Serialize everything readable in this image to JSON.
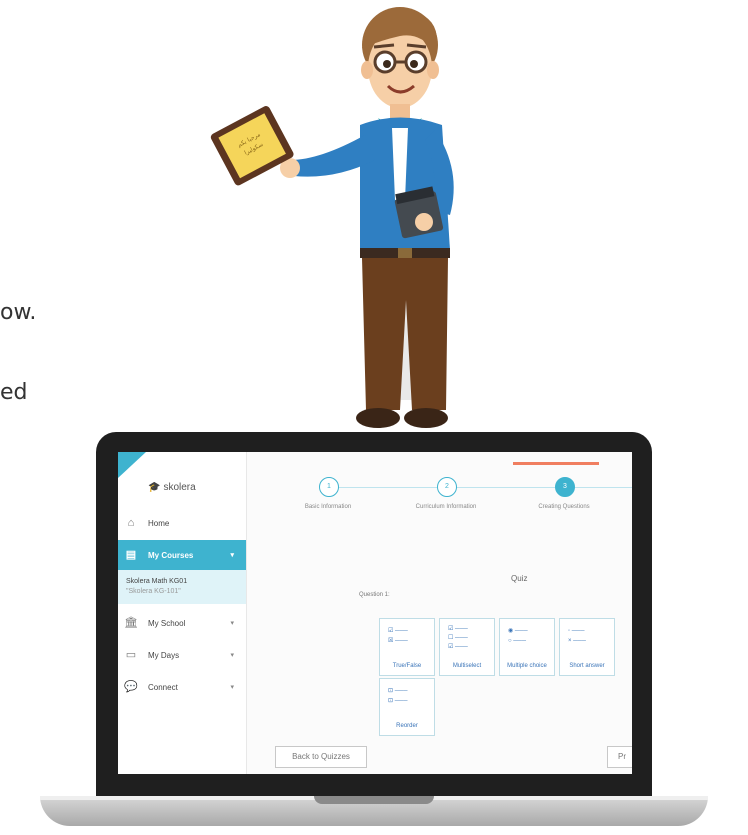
{
  "background_text": {
    "line1": "ow.",
    "line2": "ed"
  },
  "app": {
    "logo": "skolera",
    "sidebar": {
      "home": "Home",
      "my_courses": "My Courses",
      "course_name": "Skolera Math KG01",
      "course_code": "\"Skolera KG-101\"",
      "my_school": "My School",
      "my_days": "My Days",
      "connect": "Connect"
    },
    "steps": [
      {
        "number": "1",
        "label": "Basic Information"
      },
      {
        "number": "2",
        "label": "Curriculum Information"
      },
      {
        "number": "3",
        "label": "Creating Questions"
      }
    ],
    "quiz_title": "Quiz",
    "question_label": "Question 1:",
    "question_types": {
      "true_false": "True/False",
      "multiselect": "Multiselect",
      "multiple_choice": "Multiple choice",
      "short_answer": "Short answer",
      "reorder": "Reorder"
    },
    "back_button": "Back to Quizzes",
    "next_button": "Pr"
  },
  "colors": {
    "accent": "#3eb3cf",
    "active_tab": "#f07e60",
    "laptop_frame": "#1f1f1f"
  }
}
